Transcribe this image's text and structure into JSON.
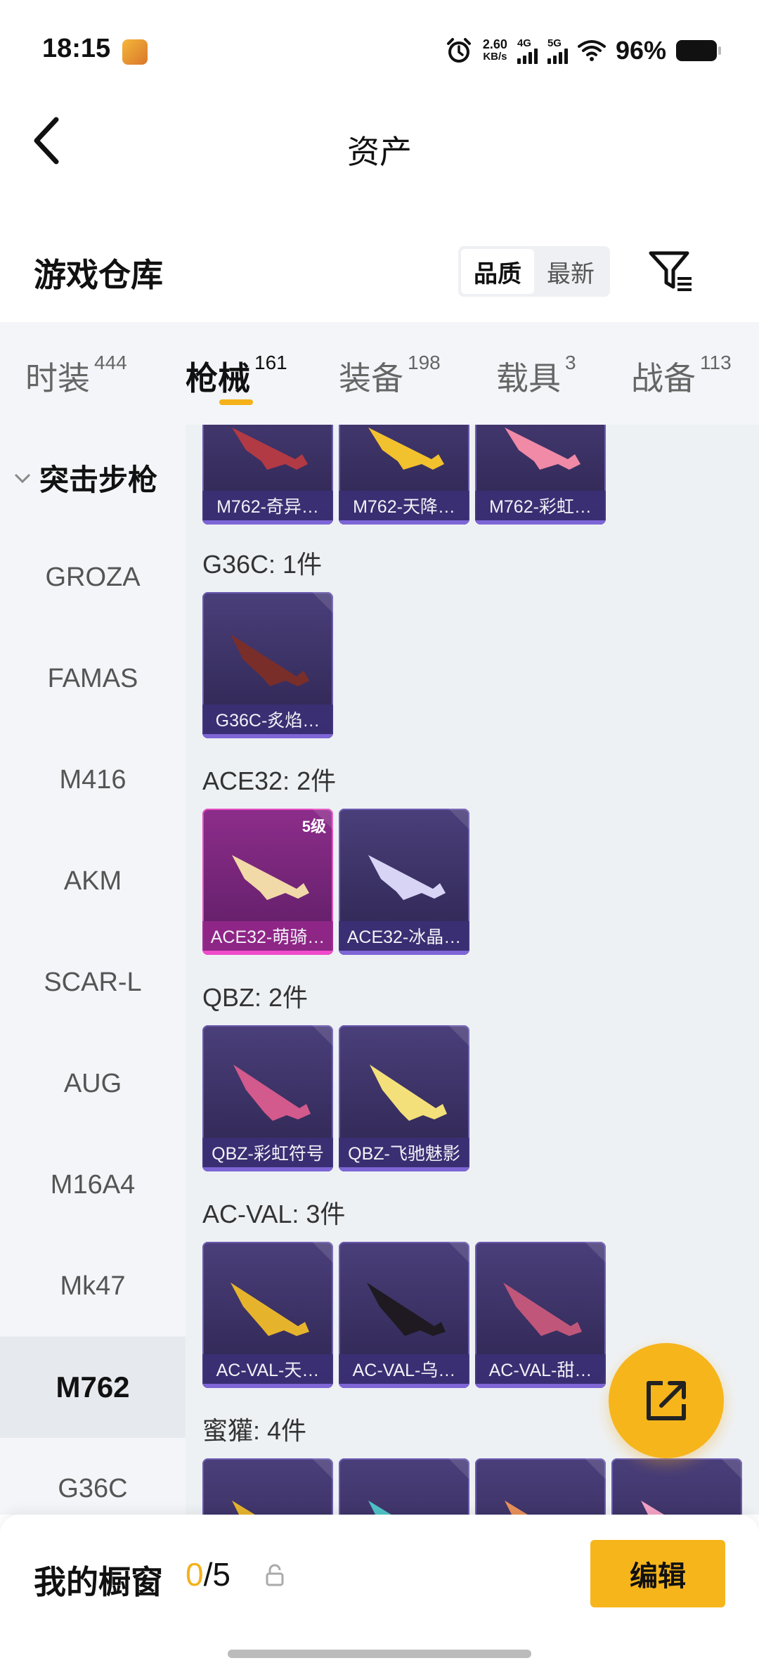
{
  "status_bar": {
    "time": "18:15",
    "net_speed": "2.60",
    "net_unit": "KB/s",
    "net1": "4G",
    "net2": "5G",
    "battery": "96%"
  },
  "header": {
    "title": "资产"
  },
  "warehouse": {
    "title": "游戏仓库",
    "sort_options": [
      "品质",
      "最新"
    ],
    "sort_selected": "品质"
  },
  "tabs": [
    {
      "label": "时装",
      "count": "444"
    },
    {
      "label": "枪械",
      "count": "161",
      "active": true
    },
    {
      "label": "装备",
      "count": "198"
    },
    {
      "label": "载具",
      "count": "3"
    },
    {
      "label": "战备",
      "count": "113"
    }
  ],
  "sidebar": {
    "category": "突击步枪",
    "items": [
      "GROZA",
      "FAMAS",
      "M416",
      "AKM",
      "SCAR-L",
      "AUG",
      "M16A4",
      "Mk47",
      "M762",
      "G36C"
    ],
    "active": "M762"
  },
  "sections": [
    {
      "label": "",
      "items": [
        "M762-奇异…",
        "M762-天降…",
        "M762-彩虹…"
      ]
    },
    {
      "label": "G36C: 1件",
      "items": [
        "G36C-炙焰…"
      ]
    },
    {
      "label": "ACE32: 2件",
      "items": [
        "ACE32-萌骑…",
        "ACE32-冰晶…"
      ],
      "badge": "5级"
    },
    {
      "label": "QBZ: 2件",
      "items": [
        "QBZ-彩虹符号",
        "QBZ-飞驰魅影"
      ]
    },
    {
      "label": "AC-VAL: 3件",
      "items": [
        "AC-VAL-天…",
        "AC-VAL-乌…",
        "AC-VAL-甜…"
      ]
    },
    {
      "label": "蜜獾: 4件",
      "items": [
        "",
        "",
        "",
        ""
      ]
    }
  ],
  "bottom": {
    "showcase_label": "我的橱窗",
    "showcase_current": "0",
    "showcase_total": "/5",
    "edit_label": "编辑"
  },
  "colors": {
    "accent": "#f7b51c",
    "card": "#3b3268",
    "card_pink": "#8d2d8b"
  }
}
